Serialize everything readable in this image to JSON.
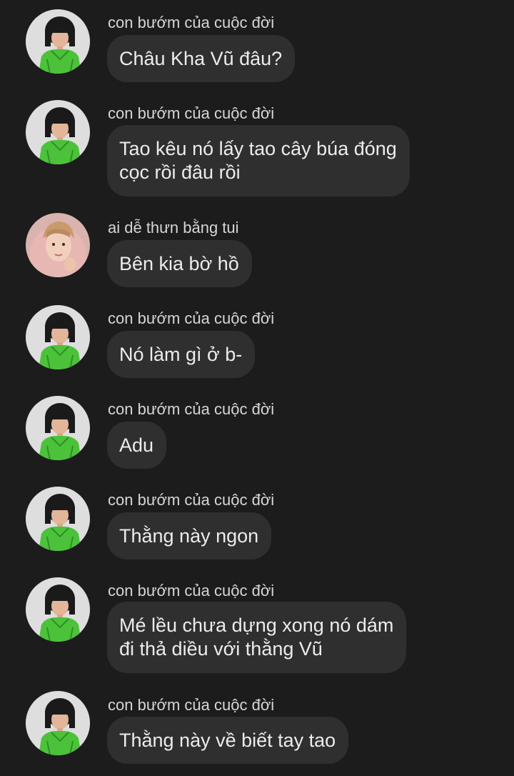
{
  "messages": [
    {
      "sender": "con bướm của cuộc đời",
      "avatar": "green-shirt-avatar-icon",
      "text": "Châu Kha Vũ đâu?"
    },
    {
      "sender": "con bướm của cuộc đời",
      "avatar": "green-shirt-avatar-icon",
      "text": "Tao kêu nó lấy tao cây búa đóng\ncọc rồi đâu rồi"
    },
    {
      "sender": "ai dễ thưn bằng tui",
      "avatar": "pink-hoodie-avatar-icon",
      "text": "Bên kia bờ hồ"
    },
    {
      "sender": "con bướm của cuộc đời",
      "avatar": "green-shirt-avatar-icon",
      "text": "Nó làm gì ở b-"
    },
    {
      "sender": "con bướm của cuộc đời",
      "avatar": "green-shirt-avatar-icon",
      "text": "Adu"
    },
    {
      "sender": "con bướm của cuộc đời",
      "avatar": "green-shirt-avatar-icon",
      "text": "Thằng này ngon"
    },
    {
      "sender": "con bướm của cuộc đời",
      "avatar": "green-shirt-avatar-icon",
      "text": "Mé lều chưa dựng xong nó dám\nđi thả diều với thằng Vũ"
    },
    {
      "sender": "con bướm của cuộc đời",
      "avatar": "green-shirt-avatar-icon",
      "text": "Thằng này về biết tay tao"
    }
  ],
  "colors": {
    "background": "#1c1c1c",
    "bubble": "#2f2f2f",
    "text": "#ececec",
    "sender": "#d6d6d6"
  }
}
